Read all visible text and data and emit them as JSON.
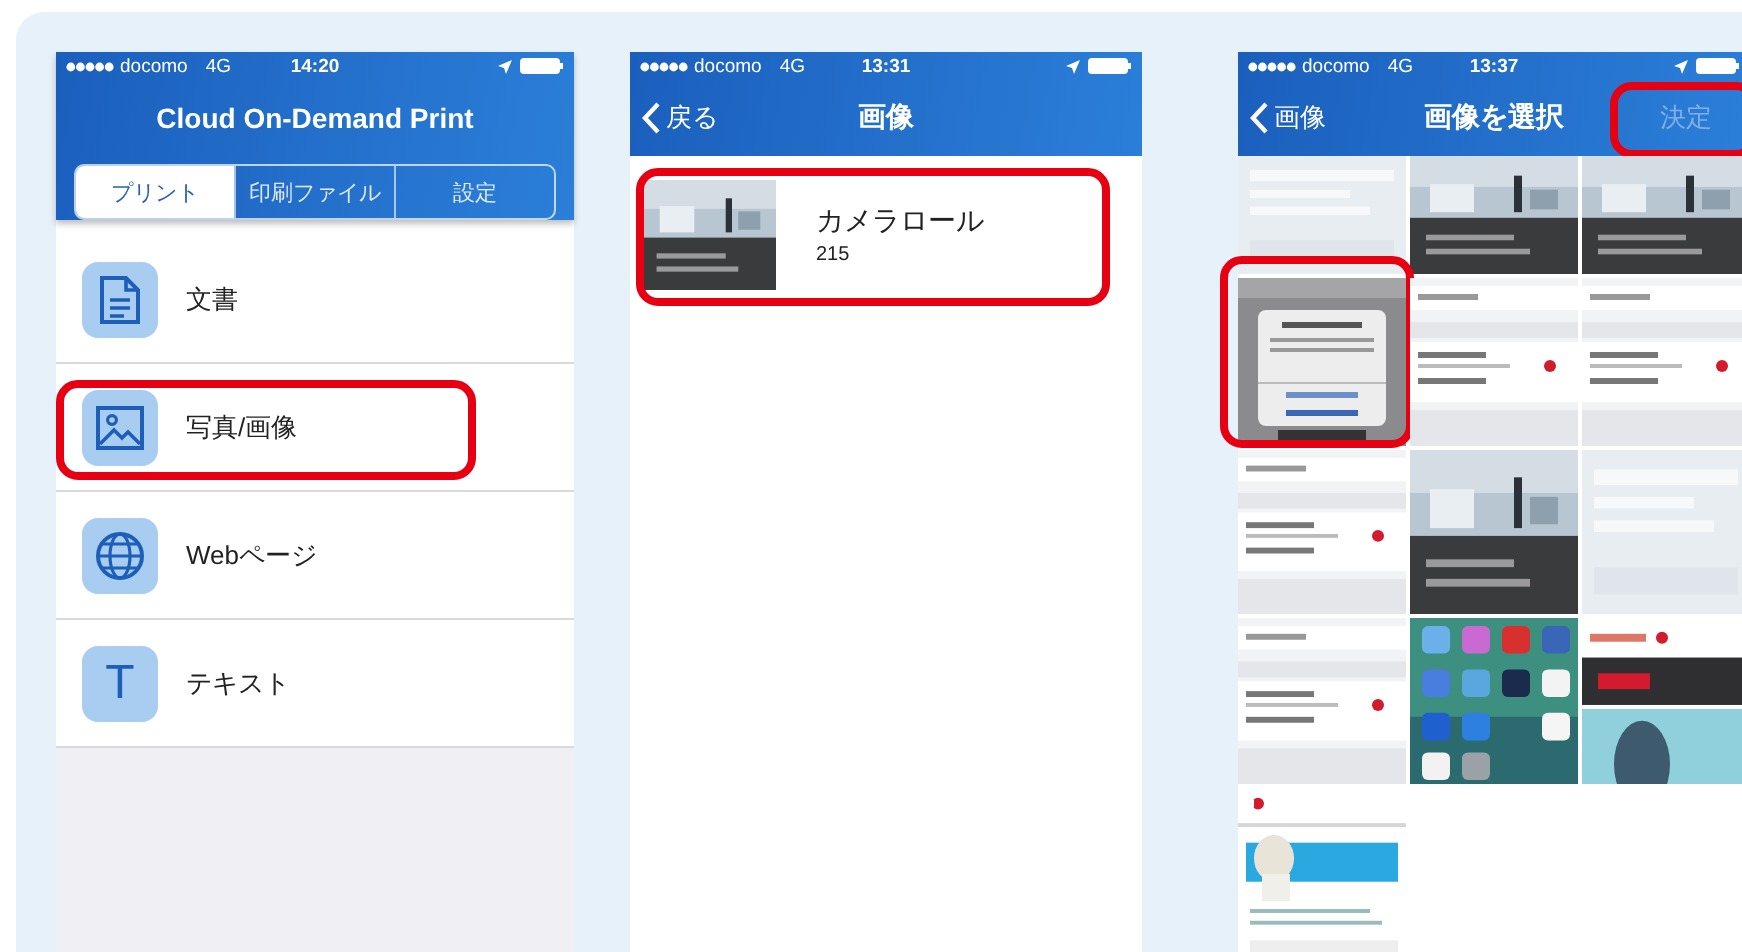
{
  "phones": [
    {
      "kind": "menu",
      "status": {
        "carrier": "docomo",
        "network": "4G",
        "time": "14:20"
      },
      "title": "Cloud On-Demand Print",
      "segments": [
        {
          "label": "プリント",
          "selected": true
        },
        {
          "label": "印刷ファイル",
          "selected": false
        },
        {
          "label": "設定",
          "selected": false
        }
      ],
      "items": [
        {
          "kind": "document",
          "label": "文書",
          "highlighted": false
        },
        {
          "label": "写真/画像",
          "highlighted": true
        },
        {
          "kind": "globe",
          "label": "Webページ",
          "highlighted": false
        },
        {
          "kind": "letter",
          "glyph": "T",
          "label": "テキスト",
          "highlighted": false
        }
      ]
    },
    {
      "kind": "albums",
      "status": {
        "carrier": "docomo",
        "network": "4G",
        "time": "13:31"
      },
      "back": "戻る",
      "title": "画像",
      "albums": [
        {
          "name": "カメラロール",
          "count": "215",
          "highlighted": true
        }
      ]
    },
    {
      "kind": "grid",
      "status": {
        "carrier": "docomo",
        "network": "4G",
        "time": "13:37"
      },
      "back": "画像",
      "title": "画像を選択",
      "action": {
        "label": "決定",
        "disabled": true,
        "highlighted": true
      },
      "photos": [
        {
          "kind": "picture",
          "highlighted": false
        },
        {
          "kind": "picture",
          "highlighted": false
        },
        {
          "kind": "picture",
          "highlighted": false
        },
        {
          "kind": "picture",
          "highlighted": true
        },
        {
          "kind": "picture",
          "highlighted": false
        },
        {
          "kind": "picture",
          "highlighted": false
        },
        {
          "kind": "picture",
          "highlighted": false
        },
        {
          "kind": "picture",
          "highlighted": false
        },
        {
          "kind": "picture",
          "highlighted": false
        },
        {
          "kind": "picture",
          "highlighted": false
        },
        {
          "kind": "picture",
          "highlighted": false
        },
        {
          "kind": "picture",
          "highlighted": false
        },
        {
          "kind": "picture",
          "highlighted": false
        }
      ]
    }
  ]
}
